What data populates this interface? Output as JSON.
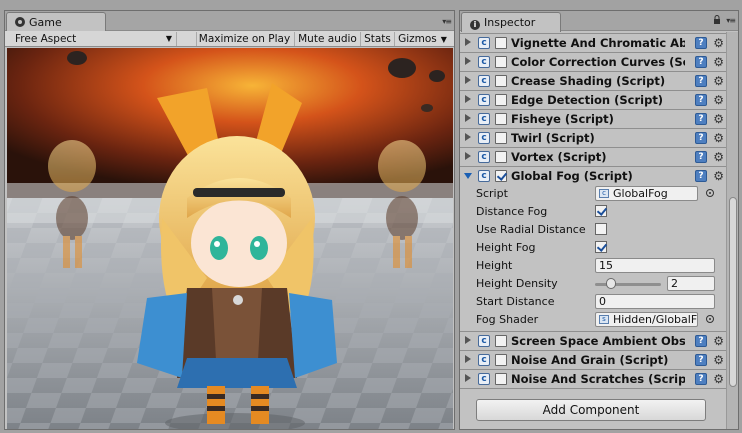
{
  "game": {
    "tab_label": "Game",
    "aspect_label": "Free Aspect",
    "buttons": [
      {
        "label": "Maximize on Play"
      },
      {
        "label": "Mute audio"
      },
      {
        "label": "Stats"
      },
      {
        "label": "Gizmos"
      }
    ]
  },
  "inspector": {
    "tab_label": "Inspector",
    "components_top": [
      {
        "title": "Vignette And Chromatic Aberration (Script)",
        "enabled": false
      },
      {
        "title": "Color Correction Curves (Script)",
        "enabled": false
      },
      {
        "title": "Crease Shading (Script)",
        "enabled": false
      },
      {
        "title": "Edge Detection (Script)",
        "enabled": false
      },
      {
        "title": "Fisheye (Script)",
        "enabled": false
      },
      {
        "title": "Twirl (Script)",
        "enabled": false
      },
      {
        "title": "Vortex (Script)",
        "enabled": false
      }
    ],
    "global_fog": {
      "title": "Global Fog (Script)",
      "enabled": true,
      "script_label": "Script",
      "script_value": "GlobalFog",
      "distance_fog_label": "Distance Fog",
      "distance_fog": true,
      "use_radial_label": "Use Radial Distance",
      "use_radial": false,
      "height_fog_label": "Height Fog",
      "height_fog": true,
      "height_label": "Height",
      "height_value": "15",
      "height_density_label": "Height Density",
      "height_density_value": "2",
      "height_density_fraction": 0.2,
      "start_distance_label": "Start Distance",
      "start_distance_value": "0",
      "fog_shader_label": "Fog Shader",
      "fog_shader_value": "Hidden/GlobalFog"
    },
    "components_bottom": [
      {
        "title": "Screen Space Ambient Obscurance (Script)",
        "enabled": false
      },
      {
        "title": "Noise And Grain (Script)",
        "enabled": false
      },
      {
        "title": "Noise And Scratches (Script)",
        "enabled": false
      }
    ],
    "add_component_label": "Add Component"
  },
  "icons": {
    "game_tab": "game-controller-icon",
    "inspector_tab": "info-icon",
    "lock": "lock-icon",
    "gear": "gear-icon",
    "help": "help-icon",
    "script": "csharp-script-icon"
  },
  "colors": {
    "panel_bg": "#c2c2c2",
    "toolbar_bg": "#d6d6d6",
    "help_blue": "#4e7fc0",
    "check_blue": "#1b4f9a"
  }
}
